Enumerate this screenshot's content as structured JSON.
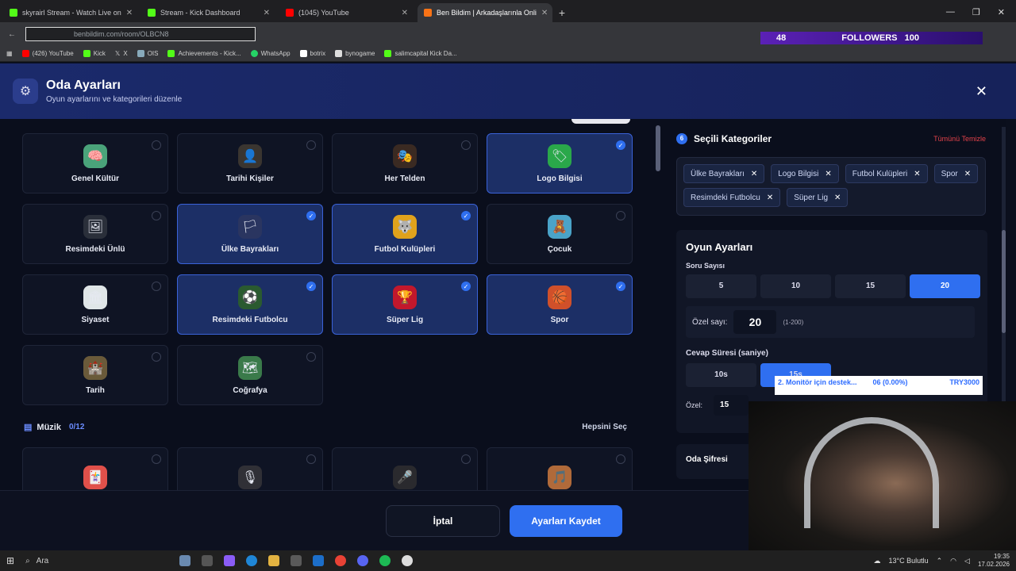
{
  "browser": {
    "tabs": [
      {
        "title": "skyrairl Stream - Watch Live on",
        "color": "#53fc18"
      },
      {
        "title": "Stream - Kick Dashboard",
        "color": "#53fc18"
      },
      {
        "title": "(1045) YouTube",
        "color": "#ff0000"
      },
      {
        "title": "Ben Bildim | Arkadaşlarınla Onli",
        "color": "#f97316"
      }
    ],
    "url": "benbildim.com/room/OLBCN8",
    "bookmarks": [
      "(426) YouTube",
      "Kick",
      "X",
      "OIS",
      "Achievements - Kick...",
      "WhatsApp",
      "botrix",
      "bynogame",
      "salimcapital Kick Da..."
    ]
  },
  "overlay": {
    "followers_count": "48",
    "followers_label": "FOLLOWERS",
    "goal": "100"
  },
  "header": {
    "title": "Oda Ayarları",
    "subtitle": "Oyun ayarlarını ve kategorileri düzenle"
  },
  "categories": [
    {
      "label": "Genel Kültür",
      "icon": "🧠",
      "bg": "#4aa37a",
      "selected": false
    },
    {
      "label": "Tarihi Kişiler",
      "icon": "👤",
      "bg": "#3a3530",
      "selected": false
    },
    {
      "label": "Her Telden",
      "icon": "🎭",
      "bg": "#3a2a22",
      "selected": false
    },
    {
      "label": "Logo Bilgisi",
      "icon": "🏷",
      "bg": "#2aa84a",
      "selected": true
    },
    {
      "label": "Resimdeki Ünlü",
      "icon": "🖼",
      "bg": "#2a2f3a",
      "selected": false
    },
    {
      "label": "Ülke Bayrakları",
      "icon": "🏳",
      "bg": "#2a3560",
      "selected": true
    },
    {
      "label": "Futbol Kulüpleri",
      "icon": "🐺",
      "bg": "#e0a21c",
      "selected": true
    },
    {
      "label": "Çocuk",
      "icon": "🧸",
      "bg": "#4aa3c8",
      "selected": false
    },
    {
      "label": "Siyaset",
      "icon": "🏛",
      "bg": "#e0e6e8",
      "selected": false
    },
    {
      "label": "Resimdeki Futbolcu",
      "icon": "⚽",
      "bg": "#2a5a30",
      "selected": true
    },
    {
      "label": "Süper Lig",
      "icon": "🏆",
      "bg": "#c2182c",
      "selected": true
    },
    {
      "label": "Spor",
      "icon": "🏀",
      "bg": "#d0502a",
      "selected": true
    },
    {
      "label": "Tarih",
      "icon": "🏰",
      "bg": "#6a5a3a",
      "selected": false
    },
    {
      "label": "Coğrafya",
      "icon": "🗺",
      "bg": "#3a7a4a",
      "selected": false
    }
  ],
  "music": {
    "title": "Müzik",
    "count": "0/12",
    "select_all": "Hepsini Seç"
  },
  "music_icons": [
    {
      "icon": "🃏",
      "bg": "#e0504a"
    },
    {
      "icon": "🎙",
      "bg": "#303036"
    },
    {
      "icon": "🎤",
      "bg": "#2a2a2e"
    },
    {
      "icon": "🎵",
      "bg": "#b06a3a"
    }
  ],
  "selected_panel": {
    "count": "6",
    "title": "Seçili Kategoriler",
    "clear_all": "Tümünü Temizle",
    "chips": [
      "Ülke Bayrakları",
      "Logo Bilgisi",
      "Futbol Kulüpleri",
      "Spor",
      "Resimdeki Futbolcu",
      "Süper Lig"
    ]
  },
  "game_settings": {
    "title": "Oyun Ayarları",
    "question_count_label": "Soru Sayısı",
    "question_options": [
      "5",
      "10",
      "15",
      "20"
    ],
    "question_selected": "20",
    "custom_label": "Özel sayı:",
    "custom_value": "20",
    "custom_hint": "(1-200)",
    "answer_time_label": "Cevap Süresi (saniye)",
    "answer_options": [
      "10s",
      "15s"
    ],
    "custom2_label": "Özel:",
    "custom2_value": "15"
  },
  "room_password": {
    "label": "Oda Şifresi"
  },
  "donation": {
    "text1": "2. Monitör için destek...",
    "text2": "06 (0.00%)",
    "text3": "TRY3000"
  },
  "footer": {
    "cancel": "İptal",
    "save": "Ayarları Kaydet"
  },
  "taskbar": {
    "search": "Ara",
    "weather": "13°C  Bulutlu",
    "time": "19:35",
    "date": "17.02.2026"
  }
}
